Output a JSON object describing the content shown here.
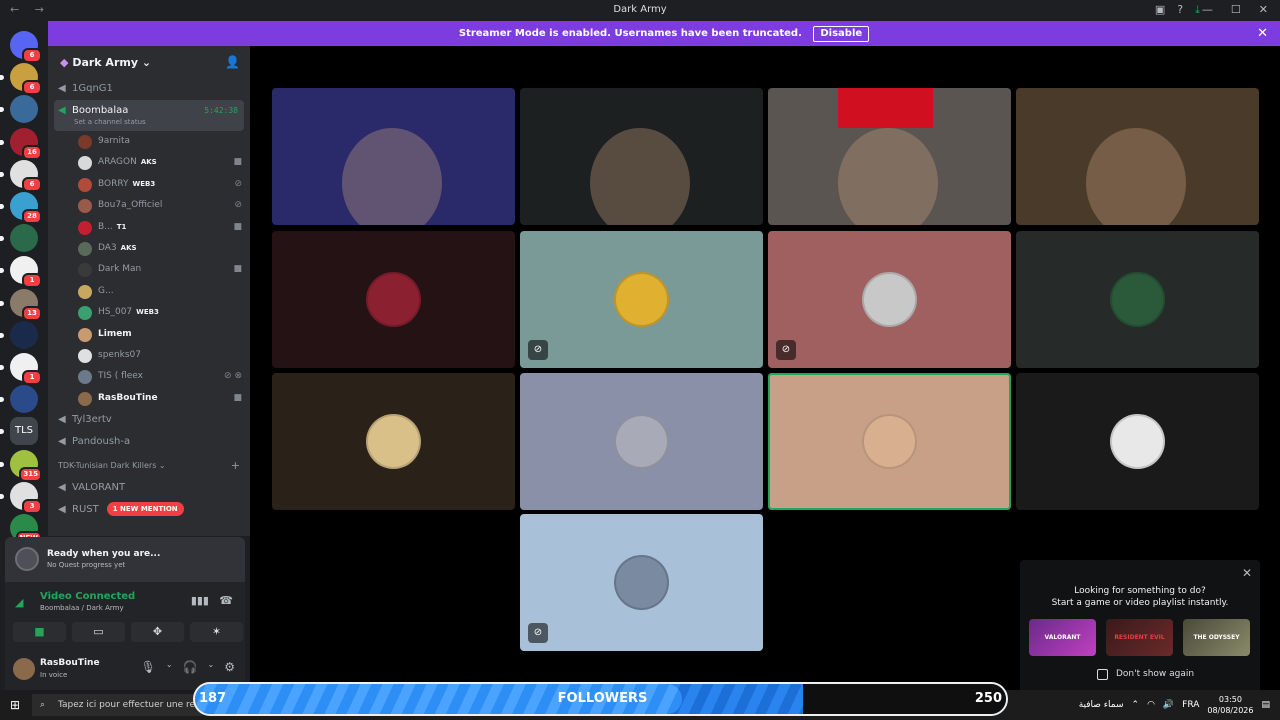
{
  "window": {
    "title": "Dark Army"
  },
  "banner": {
    "text": "Streamer Mode is enabled. Usernames have been truncated.",
    "disable_label": "Disable"
  },
  "guild_badges": [
    "6",
    "6",
    "",
    "16",
    "6",
    "28",
    "",
    "1",
    "13",
    "",
    "1",
    "",
    "",
    "315",
    "3",
    "NEW"
  ],
  "server": {
    "name": "Dark Army",
    "channels_top": [
      "1GqnG1"
    ],
    "active_channel": {
      "name": "Boombalaa",
      "time": "5:42:38",
      "status": "Set a channel status"
    },
    "voice_users": [
      {
        "name": "9arnita",
        "tag": "",
        "icons": "",
        "color": "#7a3a2a"
      },
      {
        "name": "ARAGON",
        "tag": "AKS",
        "icons": "cam",
        "color": "#d9d9d9"
      },
      {
        "name": "BORRY",
        "tag": "WEB3",
        "icons": "mute",
        "color": "#b04a3a"
      },
      {
        "name": "Bou7a_Officiel",
        "tag": "",
        "icons": "mute",
        "color": "#9a5a4a"
      },
      {
        "name": "B...",
        "tag": "T1",
        "icons": "cam",
        "color": "#c02030"
      },
      {
        "name": "DA3",
        "tag": "AKS",
        "icons": "",
        "color": "#5a6a5a"
      },
      {
        "name": "Dark Man",
        "tag": "",
        "icons": "cam",
        "color": "#3a3a3a"
      },
      {
        "name": "G...",
        "tag": "",
        "icons": "",
        "color": "#c8a860"
      },
      {
        "name": "HS_007",
        "tag": "WEB3",
        "icons": "",
        "color": "#3aa070"
      },
      {
        "name": "Limem",
        "tag": "",
        "icons": "",
        "color": "#c89a70",
        "bright": true
      },
      {
        "name": "spenks07",
        "tag": "",
        "icons": "",
        "color": "#e0e0e0"
      },
      {
        "name": "TIS ( fleex",
        "tag": "",
        "icons": "mute deaf",
        "color": "#6a7a8a"
      },
      {
        "name": "RasBouTine",
        "tag": "",
        "icons": "cam",
        "color": "#8a6a4a",
        "bright": true
      }
    ],
    "channels_bottom": [
      "Tyl3ertv",
      "Pandoush-a"
    ],
    "category": "TDK-Tunisian Dark Killers",
    "category_channels": [
      "VALORANT",
      "RUST"
    ],
    "mention_label": "1 NEW MENTION"
  },
  "quest": {
    "title": "Ready when you are...",
    "sub": "No Quest progress yet"
  },
  "voice": {
    "status": "Video Connected",
    "location": "Boombalaa / Dark Army"
  },
  "user": {
    "name": "RasBouTine",
    "status": "In voice"
  },
  "tiles": [
    {
      "kind": "video",
      "bg": "#2a2a6a"
    },
    {
      "kind": "video",
      "bg": "#1c2020"
    },
    {
      "kind": "video",
      "bg": "#5a5550"
    },
    {
      "kind": "video",
      "bg": "#4a3a2a"
    },
    {
      "kind": "avatar",
      "bg": "#241214",
      "av": "#8a2030",
      "mute": false
    },
    {
      "kind": "avatar",
      "bg": "#7a9a98",
      "av": "#e0b030",
      "mute": true
    },
    {
      "kind": "avatar",
      "bg": "#a06060",
      "av": "#c8c8c8",
      "mute": true
    },
    {
      "kind": "avatar",
      "bg": "#262a28",
      "av": "#2a5a3a",
      "mute": false
    },
    {
      "kind": "avatar",
      "bg": "#2a2218",
      "av": "#d8c088",
      "mute": false
    },
    {
      "kind": "avatar",
      "bg": "#8a90a8",
      "av": "#a8aab8",
      "mute": false
    },
    {
      "kind": "avatar",
      "bg": "#c8a088",
      "av": "#d8b090",
      "mute": false,
      "speaking": true
    },
    {
      "kind": "avatar",
      "bg": "#1a1a1a",
      "av": "#e8e8e8",
      "mute": false
    },
    {
      "kind": "avatar",
      "bg": "#a8c0d8",
      "av": "#7a8aa0",
      "mute": true
    }
  ],
  "activity": {
    "line1": "Looking for something to do?",
    "line2": "Start a game or video playlist instantly.",
    "games": [
      "VALORANT",
      "RESIDENT EVIL",
      "THE ODYSSEY"
    ],
    "dont_show": "Don't show again"
  },
  "taskbar": {
    "search_placeholder": "Tapez ici pour effectuer une re",
    "weather": "سماء صافية",
    "lang": "FRA",
    "time": "03:50",
    "date": "08/08/2026"
  },
  "followers": {
    "label": "FOLLOWERS",
    "current": "187",
    "goal": "250",
    "progress": 0.75
  }
}
